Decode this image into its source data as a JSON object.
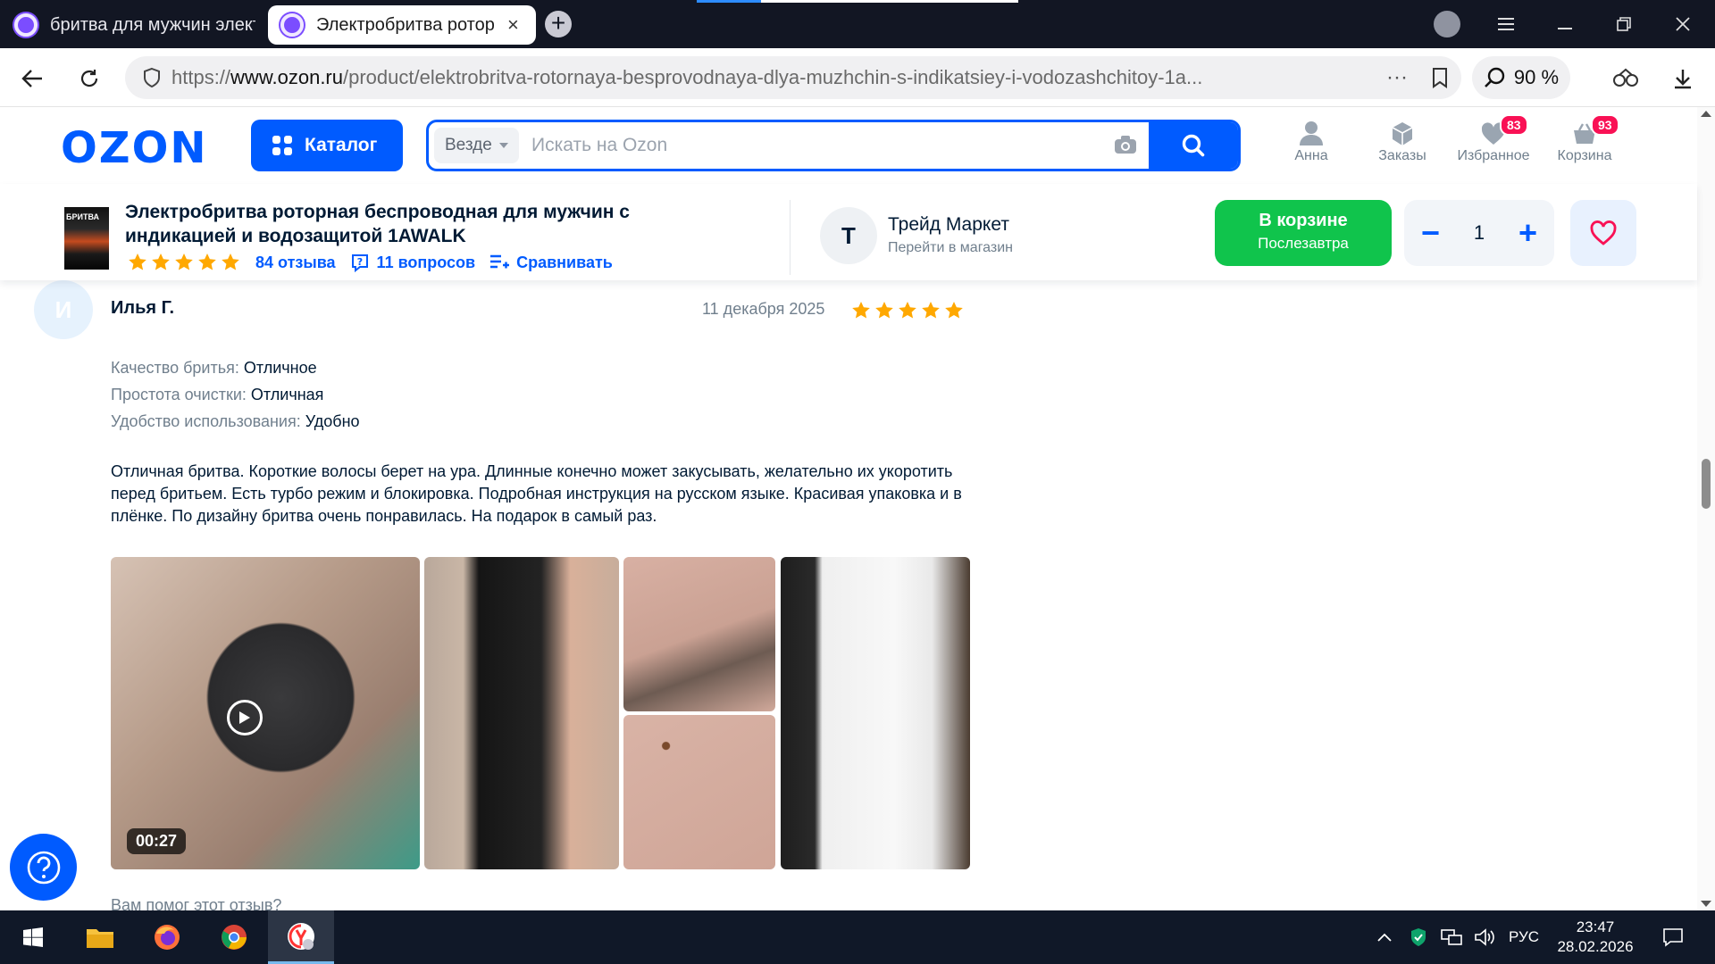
{
  "browser": {
    "tabs": [
      {
        "title": "бритва для мужчин элект"
      },
      {
        "title": "Электробритва ротор"
      }
    ],
    "tab_close": "×",
    "new_tab": "+",
    "address": {
      "scheme": "https://",
      "host": "www.ozon.ru",
      "path": "/product/elektrobritva-rotornaya-besprovodnaya-dlya-muzhchin-s-indikatsiey-i-vodozashchitoy-1a...",
      "more": "···"
    },
    "zoom": "90 %"
  },
  "ozon": {
    "logo": "OZON",
    "catalog_label": "Каталог",
    "search": {
      "scope": "Везде",
      "placeholder": "Искать на Ozon"
    },
    "header_items": [
      {
        "label": "Анна",
        "icon": "user-icon"
      },
      {
        "label": "Заказы",
        "icon": "box-icon"
      },
      {
        "label": "Избранное",
        "icon": "heart-icon",
        "badge": "83"
      },
      {
        "label": "Корзина",
        "icon": "cart-icon",
        "badge": "93"
      }
    ]
  },
  "product": {
    "thumb_text": "БРИТВА",
    "title": "Электробритва роторная беспроводная для мужчин с индикацией и водозащитой 1AWALK",
    "rating_stars": 5,
    "reviews_link": "84 отзыва",
    "questions_link": "11 вопросов",
    "compare_link": "Сравнивать",
    "seller": {
      "initial": "Т",
      "name": "Трейд Маркет",
      "sub": "Перейти в магазин"
    },
    "cart_button": {
      "line1": "В корзине",
      "line2": "Послезавтра"
    },
    "quantity": "1",
    "minus": "−",
    "plus": "+"
  },
  "review": {
    "avatar_initial": "И",
    "author": "Илья Г.",
    "date": "11 декабря 2025",
    "stars": 5,
    "attributes": [
      {
        "key": "Качество бритья:",
        "value": "Отличное"
      },
      {
        "key": "Простота очистки:",
        "value": "Отличная"
      },
      {
        "key": "Удобство использования:",
        "value": "Удобно"
      }
    ],
    "text": "Отличная бритва. Короткие волосы берет на ура. Длинные конечно может закусывать, желательно их укоротить перед бритьем. Есть турбо режим и блокировка. Подробная инструкция на русском языке. Красивая упаковка и в плёнке. По дизайну бритва очень понравилась. На подарок в самый раз.",
    "video_duration": "00:27",
    "helpful_prompt": "Вам помог этот отзыв?"
  },
  "taskbar": {
    "language": "РУС",
    "time": "23:47",
    "date": "28.02.2026"
  },
  "colors": {
    "ozon_blue": "#005bff",
    "cart_green": "#10c44c",
    "star": "#ffa800",
    "badge": "#f91155"
  }
}
